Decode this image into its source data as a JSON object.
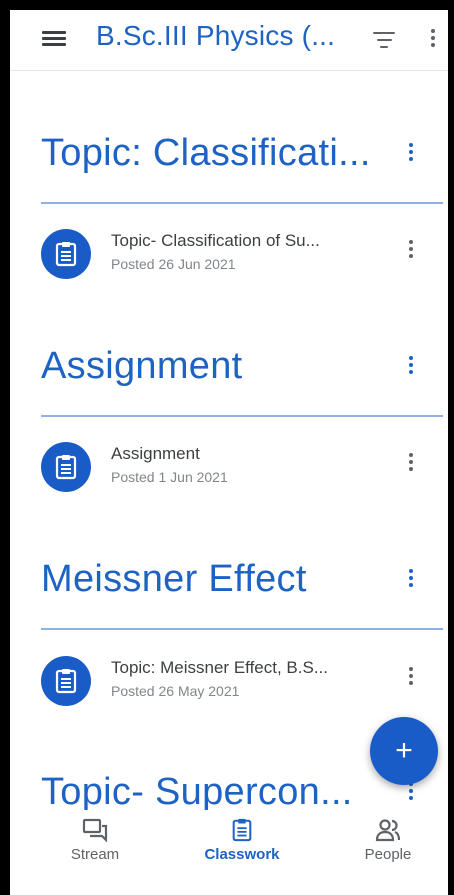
{
  "app_bar": {
    "title": "B.Sc.III Physics (...",
    "menu_icon": "hamburger-menu-icon",
    "filter_icon": "filter-icon",
    "more_icon": "more-vert-icon"
  },
  "topics": [
    {
      "heading": "Topic: Classificati...",
      "items": [
        {
          "title": "Topic- Classification of Su...",
          "date": "Posted 26 Jun 2021",
          "icon": "assignment-icon"
        }
      ]
    },
    {
      "heading": "Assignment",
      "items": [
        {
          "title": "Assignment",
          "date": "Posted 1 Jun 2021",
          "icon": "assignment-icon"
        }
      ]
    },
    {
      "heading": "Meissner Effect",
      "items": [
        {
          "title": "Topic: Meissner Effect, B.S...",
          "date": "Posted 26 May 2021",
          "icon": "assignment-icon"
        }
      ]
    },
    {
      "heading": "Topic- Supercon...",
      "items": []
    }
  ],
  "fab": {
    "label": "+",
    "icon": "add-icon"
  },
  "bottom_nav": [
    {
      "label": "Stream",
      "icon": "stream-icon",
      "active": false
    },
    {
      "label": "Classwork",
      "icon": "classwork-icon",
      "active": true
    },
    {
      "label": "People",
      "icon": "people-icon",
      "active": false
    }
  ],
  "colors": {
    "accent": "#1e63c4",
    "icon_bg": "#1a5cc7",
    "divider": "#8fb1e3",
    "text": "#3c4043",
    "subtext": "#80868b"
  }
}
